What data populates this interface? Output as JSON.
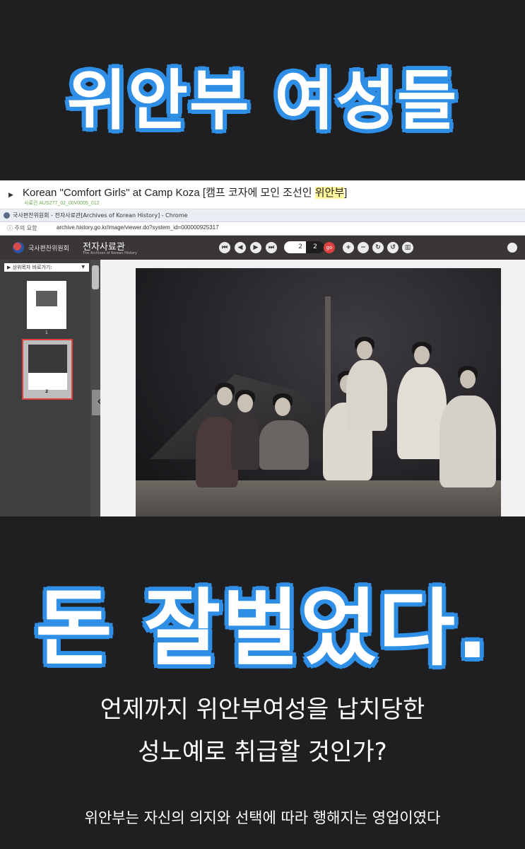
{
  "headline_top": "위안부 여성들",
  "headline_mid": "돈 잘벌었다.",
  "question_line1": "언제까지 위안부여성을 납치당한",
  "question_line2": "성노예로 취급할 것인가?",
  "bottom_text": "위안부는 자신의 의지와 선택에 따라 행해지는 영업이였다",
  "accent_color": "#2f8fe6",
  "screenshot": {
    "result_title_pre": "Korean \"Comfort Girls\" at Camp Koza [캠프 코자에 모인 조선인 ",
    "result_title_highlight": "위안부",
    "result_title_post": "]",
    "result_id": "사료건 AUS277_02_00V0005_012",
    "window_title": "국사편찬위원회 - 전자사료관[Archives of Korean History] - Chrome",
    "address_info": "ⓘ 주의 요함",
    "address_url": "archive.history.go.kr/image/viewer.do?system_id=000000925317",
    "org_name": "국사편찬위원회",
    "brand_name": "전자사료관",
    "brand_sub": "The Archives of Korean History",
    "page_current": "2",
    "page_total": "2",
    "go_label": "go",
    "nav_dropdown": "▶ 상위목차 바로가기:",
    "thumbs": [
      {
        "num": "1"
      },
      {
        "num": "2"
      }
    ],
    "toolbar_icons": [
      "first-icon",
      "prev-icon",
      "next-icon",
      "last-icon",
      "zoom-in-icon",
      "zoom-out-icon",
      "rotate-right-icon",
      "rotate-left-icon",
      "fit-icon",
      "print-icon"
    ]
  }
}
